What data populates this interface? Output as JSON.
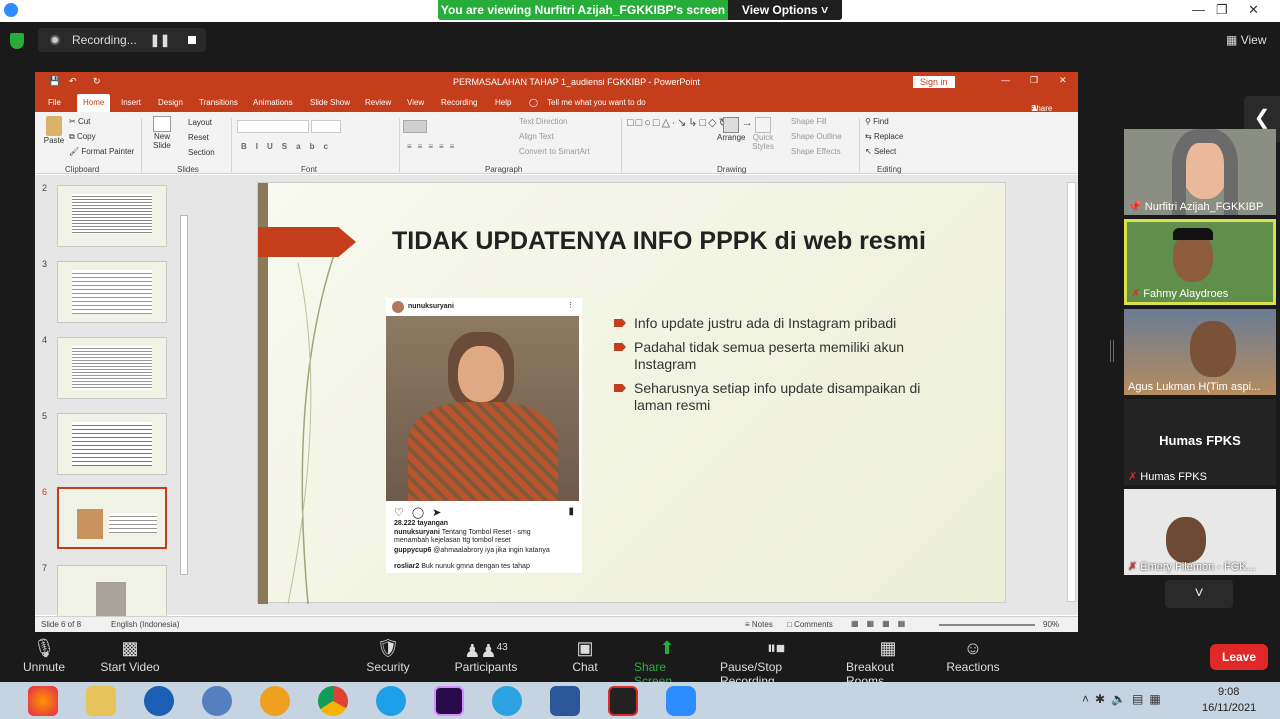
{
  "zoom": {
    "banner_text": "You are viewing Nurfitri Azijah_FGKKIBP's screen",
    "view_options": "View Options",
    "recording": "Recording...",
    "view": "View",
    "leave": "Leave",
    "participants_count": "43"
  },
  "toolbar": [
    {
      "label": "Unmute",
      "icon": "mic-muted-icon"
    },
    {
      "label": "Start Video",
      "icon": "video-off-icon"
    },
    {
      "label": "Security",
      "icon": "shield-icon"
    },
    {
      "label": "Participants",
      "icon": "people-icon"
    },
    {
      "label": "Chat",
      "icon": "chat-icon"
    },
    {
      "label": "Share Screen",
      "icon": "share-screen-icon"
    },
    {
      "label": "Pause/Stop Recording",
      "icon": "pause-stop-icon"
    },
    {
      "label": "Breakout Rooms",
      "icon": "breakout-icon"
    },
    {
      "label": "Reactions",
      "icon": "emoji-icon"
    }
  ],
  "videos": [
    {
      "name": "Nurfitri Azijah_FGKKIBP"
    },
    {
      "name": "Fahmy Alaydroes"
    },
    {
      "name": "Agus Lukman H(Tim aspi..."
    },
    {
      "name": "Humas FPKS",
      "tile_text": "Humas FPKS"
    },
    {
      "name": "Emery Filemon - FGK..."
    }
  ],
  "ppt": {
    "title": "PERMASALAHAN TAHAP 1_audiensi FGKKIBP  -  PowerPoint",
    "sign_in": "Sign in",
    "share": "Share",
    "tell_me": "Tell me what you want to do",
    "tabs": [
      "File",
      "Home",
      "Insert",
      "Design",
      "Transitions",
      "Animations",
      "Slide Show",
      "Review",
      "View",
      "Recording",
      "Help"
    ],
    "ribbon": {
      "paste": "Paste",
      "cut": "Cut",
      "copy": "Copy",
      "format_painter": "Format Painter",
      "new_slide": "New Slide",
      "layout": "Layout",
      "reset": "Reset",
      "section": "Section",
      "text_direction": "Text Direction",
      "align_text": "Align Text",
      "smartart": "Convert to SmartArt",
      "arrange": "Arrange",
      "quick_styles": "Quick Styles",
      "shape_fill": "Shape Fill",
      "shape_outline": "Shape Outline",
      "shape_effects": "Shape Effects",
      "find": "Find",
      "replace": "Replace",
      "select": "Select",
      "groups": [
        "Clipboard",
        "Slides",
        "Font",
        "Paragraph",
        "Drawing",
        "Editing"
      ]
    },
    "thumb_numbers": [
      "2",
      "3",
      "4",
      "5",
      "6",
      "7"
    ],
    "status": {
      "slide": "Slide 6 of 8",
      "lang": "English (Indonesia)",
      "notes": "Notes",
      "comments": "Comments",
      "zoom": "90%"
    }
  },
  "slide": {
    "title": "TIDAK UPDATENYA INFO PPPK di web resmi",
    "bullets": [
      "Info update justru ada di Instagram pribadi",
      "Padahal tidak semua peserta memiliki akun Instagram",
      "Seharusnya setiap info update disampaikan di laman resmi"
    ],
    "insta": {
      "user": "nunuksuryani",
      "views": "28.222 tayangan",
      "caption_user": "nunuksuryani",
      "caption": "Tentang Tombol Reset - smg menambah kejelasan ttg tombol reset",
      "comment1_user": "guppycup6",
      "comment1": "@ahmaalabrory iya jika ingin katanya",
      "comment2_user": "rosliar2",
      "comment2": "Buk nunuk gmna dengan tes tahap"
    }
  },
  "taskbar": {
    "time": "9:08",
    "date": "16/11/2021"
  },
  "colors": {
    "zoom_green": "#27ae3a",
    "ppt_red": "#c43e1c",
    "leave_red": "#e02828",
    "slide_bullet": "#c43e1c"
  }
}
